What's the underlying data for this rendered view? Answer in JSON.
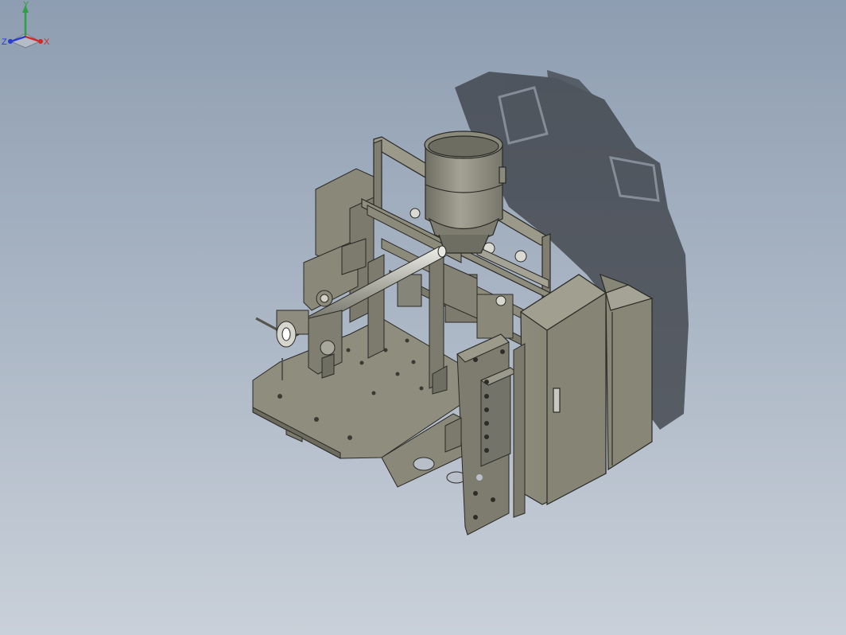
{
  "viewport": {
    "background_top": "#8e9db1",
    "background_bottom": "#c9d0d9",
    "model_color": "#8f8e7e",
    "model_edge_color": "#2a2a26",
    "shadow_color": "#3c4046"
  },
  "triad": {
    "x_label": "X",
    "y_label": "Y",
    "z_label": "Z",
    "x_color": "#d2282a",
    "y_color": "#2ea043",
    "z_color": "#2a3ccf"
  }
}
